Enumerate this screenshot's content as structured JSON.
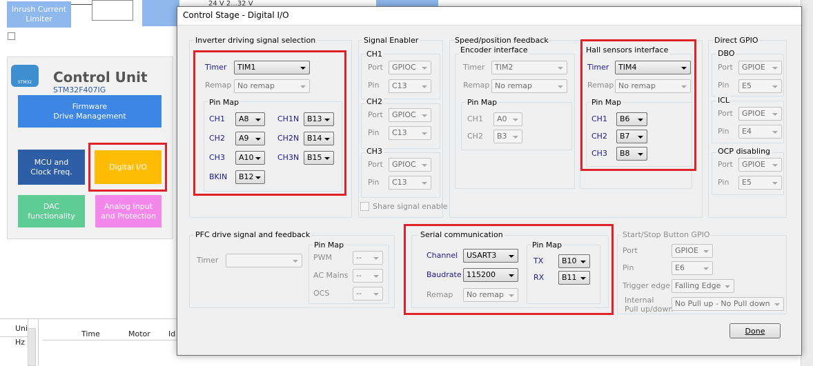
{
  "background": {
    "inrush_block": "Inrush Current\nLimiter",
    "voltage_label": "24 V 2...32 V",
    "control_unit": {
      "logo_text": "STM32",
      "title": "Control Unit",
      "subtitle": "STM32F407IG",
      "blocks": [
        {
          "id": "firmware",
          "label": "Firmware\nDrive Management",
          "color": "#3d86e4"
        },
        {
          "id": "mcu",
          "label": "MCU and\nClock Freq.",
          "color": "#2d5ea6"
        },
        {
          "id": "digital-io",
          "label": "Digital I/O",
          "color": "#ffbc05"
        },
        {
          "id": "dac",
          "label": "DAC\nfunctionality",
          "color": "#5fcb95"
        },
        {
          "id": "analog",
          "label": "Analog Input\nand Protection",
          "color": "#f387ea"
        }
      ]
    },
    "bottom_table": {
      "left_headers": [
        "Uni",
        "Hz"
      ],
      "headers": [
        "Time",
        "Motor",
        "Id"
      ]
    }
  },
  "dialog": {
    "title": "Control Stage - Digital I/O",
    "inverter": {
      "group_label": "Inverter driving signal selection",
      "timer_label": "Timer",
      "timer_value": "TIM1",
      "remap_label": "Remap",
      "remap_value": "No remap",
      "pinmap_label": "Pin Map",
      "pins": [
        {
          "name": "CH1",
          "value": "A8",
          "name2": "CH1N",
          "value2": "B13"
        },
        {
          "name": "CH2",
          "value": "A9",
          "name2": "CH2N",
          "value2": "B14"
        },
        {
          "name": "CH3",
          "value": "A10",
          "name2": "CH3N",
          "value2": "B15"
        },
        {
          "name": "BKIN",
          "value": "B12"
        }
      ]
    },
    "signal_enabler": {
      "group_label": "Signal Enabler",
      "channels": [
        {
          "label": "CH1",
          "port_label": "Port",
          "port": "GPIOC",
          "pin_label": "Pin",
          "pin": "C13"
        },
        {
          "label": "CH2",
          "port_label": "Port",
          "port": "GPIOC",
          "pin_label": "Pin",
          "pin": "C13"
        },
        {
          "label": "CH3",
          "port_label": "Port",
          "port": "GPIOC",
          "pin_label": "Pin",
          "pin": "C13"
        }
      ],
      "share_label": "Share signal enable"
    },
    "speed_feedback": {
      "group_label": "Speed/position feedback",
      "encoder": {
        "label": "Encoder interface",
        "timer_label": "Timer",
        "timer_value": "TIM2",
        "remap_label": "Remap",
        "remap_value": "No remap",
        "pinmap_label": "Pin Map",
        "ch1_label": "CH1",
        "ch1_value": "A0",
        "ch2_label": "CH2",
        "ch2_value": "B3"
      },
      "hall": {
        "label": "Hall sensors interface",
        "timer_label": "Timer",
        "timer_value": "TIM4",
        "remap_label": "Remap",
        "remap_value": "No remap",
        "pinmap_label": "Pin Map",
        "ch1_label": "CH1",
        "ch1_value": "B6",
        "ch2_label": "CH2",
        "ch2_value": "B7",
        "ch3_label": "CH3",
        "ch3_value": "B8"
      }
    },
    "direct_gpio": {
      "group_label": "Direct GPIO",
      "dbo": {
        "label": "DBO",
        "port_label": "Port",
        "port": "GPIOE",
        "pin_label": "Pin",
        "pin": "E5"
      },
      "icl": {
        "label": "ICL",
        "port_label": "Port",
        "port": "GPIOE",
        "pin_label": "Pin",
        "pin": "E4"
      },
      "ocp": {
        "label": "OCP disabling",
        "port_label": "Port",
        "port": "GPIOE",
        "pin_label": "Pin",
        "pin": "E5"
      }
    },
    "pfc": {
      "group_label": "PFC drive signal and feedback",
      "timer_label": "Timer",
      "timer_value": "",
      "pinmap_label": "Pin Map",
      "pwm_label": "PWM",
      "pwm_value": "--",
      "acmains_label": "AC Mains",
      "acmains_value": "--",
      "ocs_label": "OCS",
      "ocs_value": "--"
    },
    "serial": {
      "group_label": "Serial communication",
      "channel_label": "Channel",
      "channel_value": "USART3",
      "baud_label": "Baudrate",
      "baud_value": "115200",
      "remap_label": "Remap",
      "remap_value": "No remap",
      "pinmap_label": "Pin Map",
      "tx_label": "TX",
      "tx_value": "B10",
      "rx_label": "RX",
      "rx_value": "B11"
    },
    "startstop": {
      "group_label": "Start/Stop Button GPIO",
      "port_label": "Port",
      "port_value": "GPIOE",
      "pin_label": "Pin",
      "pin_value": "E6",
      "trigger_label": "Trigger edge",
      "trigger_value": "Falling Edge",
      "pull_label_1": "Internal",
      "pull_label_2": "Pull up/down",
      "pull_value": "No Pull up - No Pull down"
    },
    "done_label": "Done"
  },
  "colors": {
    "highlight_red": "#e0202a",
    "label_blue": "#1a1a8c"
  }
}
